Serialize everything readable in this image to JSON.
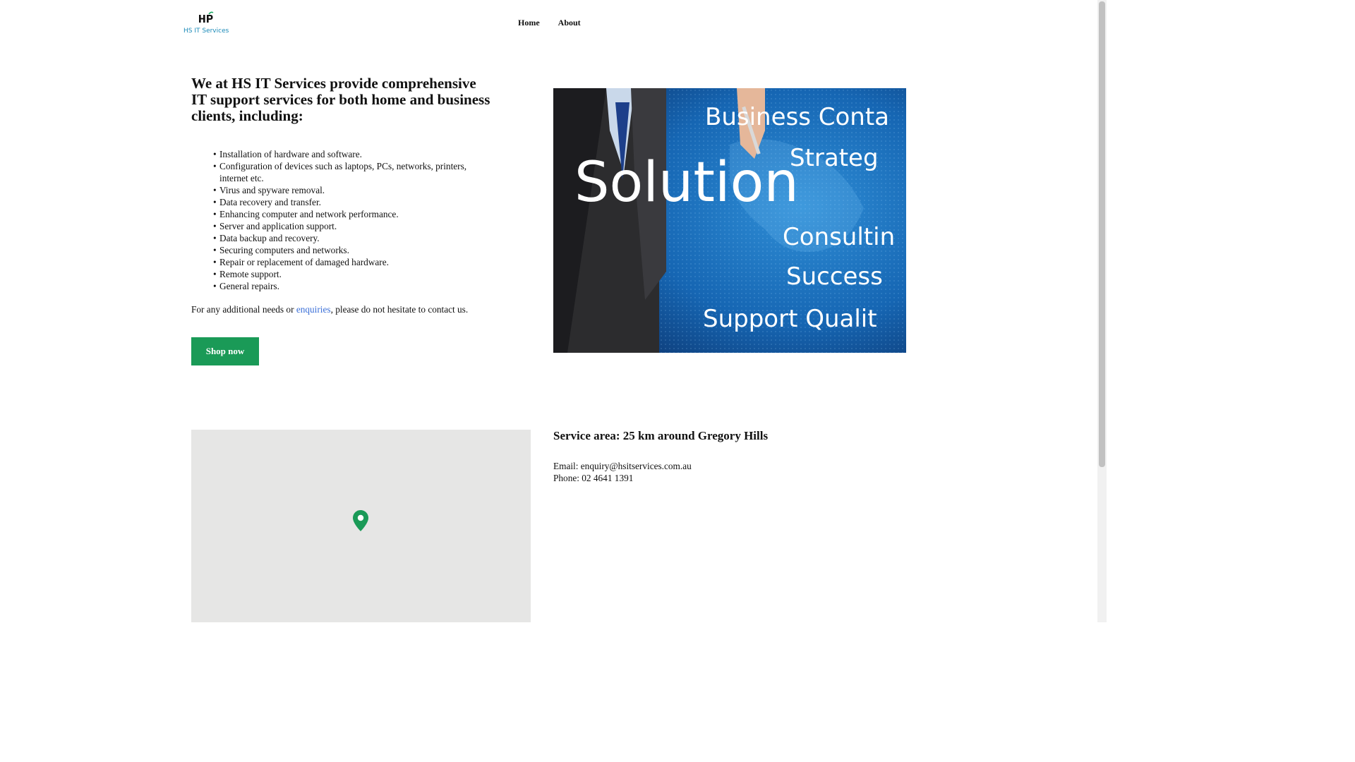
{
  "header": {
    "logo_text": "HS IT Services",
    "nav": {
      "home": "Home",
      "about": "About"
    }
  },
  "intro": {
    "heading": "We at HS IT Services provide comprehensive IT support services for both home and business clients, including:",
    "services": [
      "Installation of hardware and software.",
      "Configuration of devices such as laptops, PCs, networks, printers, internet etc.",
      "Virus and spyware removal.",
      "Data recovery and transfer.",
      "Enhancing computer and network performance.",
      "Server and application support.",
      "Data backup and recovery.",
      "Securing computers and networks.",
      "Repair or replacement of damaged hardware.",
      "Remote support.",
      "General repairs."
    ],
    "contact_prefix": "For any additional needs or ",
    "contact_link": "enquiries",
    "contact_suffix": ", please do not hesitate to contact us.",
    "button_label": "Shop now"
  },
  "hero_image": {
    "words": [
      "Solution",
      "Business Conta",
      "Strateg",
      "Consultin",
      "Success",
      "Support Qualit"
    ]
  },
  "service_area": {
    "title": "Service area: 25 km around Gregory Hills",
    "email_line": "Email: enquiry@hsitservices.com.au",
    "phone_line": "Phone: 02 4641 1391"
  },
  "colors": {
    "accent_green": "#1a9a57",
    "link_blue": "#3a6fd8",
    "logo_blue": "#1a8ab8",
    "map_bg": "#e6e6e5"
  },
  "icons": {
    "logo": "hsp-logo-icon",
    "map_marker": "map-pin-icon"
  }
}
